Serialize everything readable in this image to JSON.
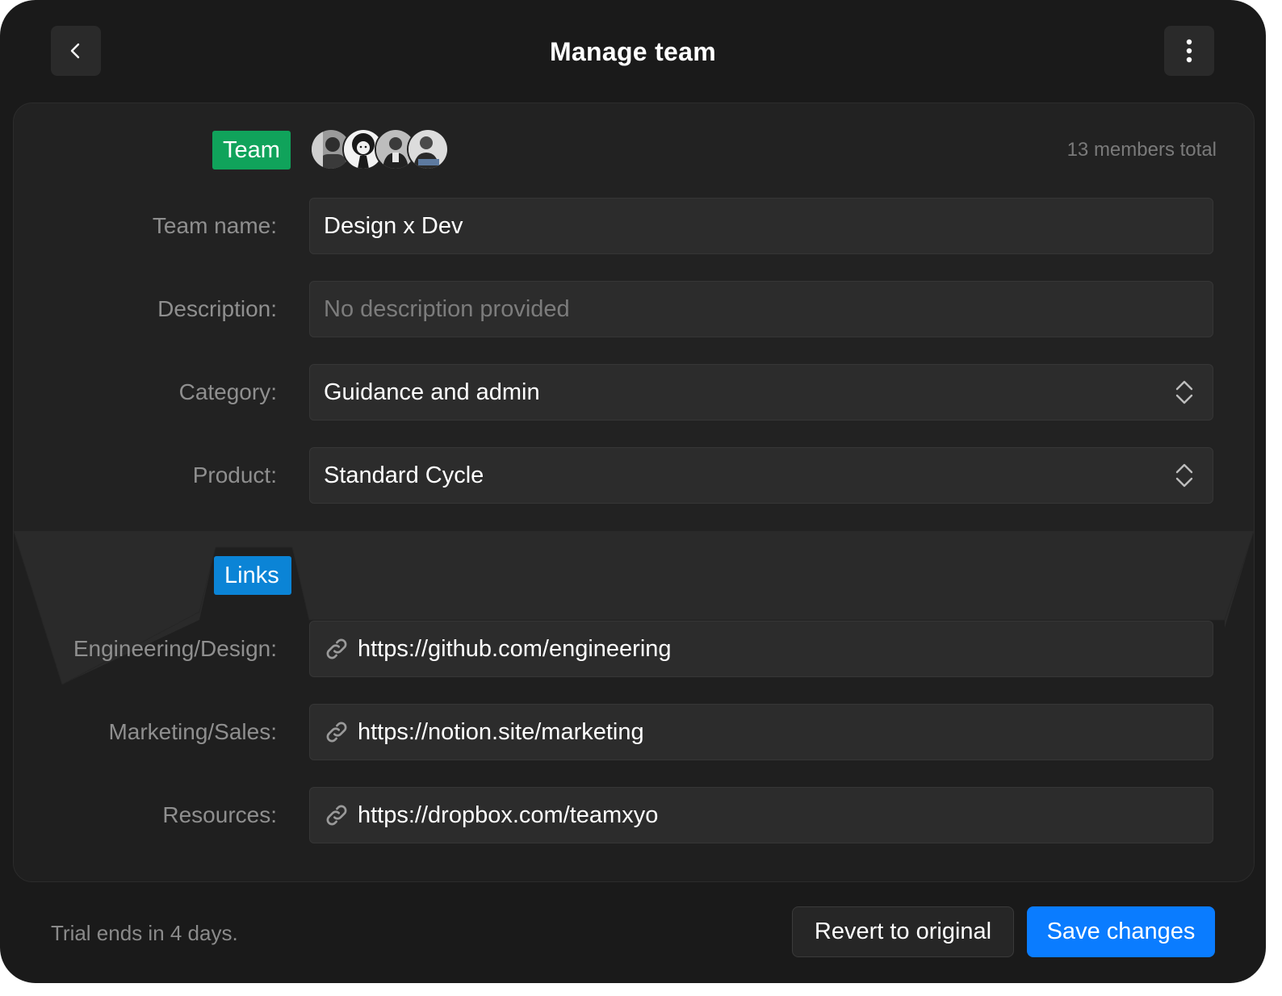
{
  "header": {
    "title": "Manage team",
    "back_icon": "chevron-left-icon",
    "more_icon": "vertical-ellipsis-icon"
  },
  "team_section": {
    "badge": "Team",
    "badge_color": "#10a35b",
    "members_total": "13 members total",
    "avatars": [
      "member-avatar-1",
      "member-avatar-2",
      "member-avatar-3",
      "member-avatar-4"
    ]
  },
  "fields": {
    "team_name": {
      "label": "Team name:",
      "value": "Design x Dev"
    },
    "description": {
      "label": "Description:",
      "placeholder": "No description provided"
    },
    "category": {
      "label": "Category:",
      "value": "Guidance and admin"
    },
    "product": {
      "label": "Product:",
      "value": "Standard Cycle"
    }
  },
  "links_section": {
    "badge": "Links",
    "badge_color": "#0b84d6",
    "items": [
      {
        "label": "Engineering/Design:",
        "url": "https://github.com/engineering"
      },
      {
        "label": "Marketing/Sales:",
        "url": "https://notion.site/marketing"
      },
      {
        "label": "Resources:",
        "url": "https://dropbox.com/teamxyo"
      }
    ]
  },
  "footer": {
    "trial_text": "Trial ends in 4 days.",
    "revert_label": "Revert to original",
    "save_label": "Save changes",
    "accent_color": "#0a7cff"
  }
}
